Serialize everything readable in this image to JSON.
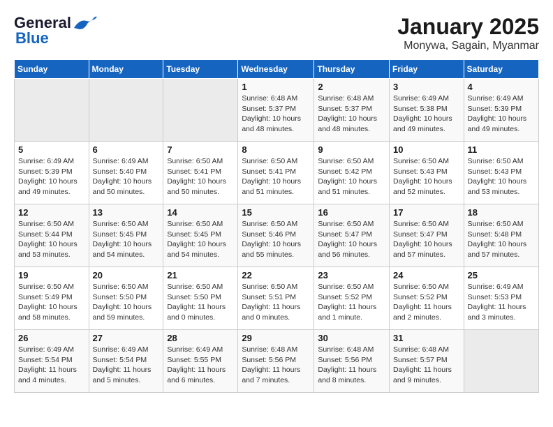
{
  "logo": {
    "line1": "General",
    "line2": "Blue"
  },
  "title": "January 2025",
  "subtitle": "Monywa, Sagain, Myanmar",
  "weekdays": [
    "Sunday",
    "Monday",
    "Tuesday",
    "Wednesday",
    "Thursday",
    "Friday",
    "Saturday"
  ],
  "weeks": [
    [
      {
        "day": "",
        "info": ""
      },
      {
        "day": "",
        "info": ""
      },
      {
        "day": "",
        "info": ""
      },
      {
        "day": "1",
        "info": "Sunrise: 6:48 AM\nSunset: 5:37 PM\nDaylight: 10 hours\nand 48 minutes."
      },
      {
        "day": "2",
        "info": "Sunrise: 6:48 AM\nSunset: 5:37 PM\nDaylight: 10 hours\nand 48 minutes."
      },
      {
        "day": "3",
        "info": "Sunrise: 6:49 AM\nSunset: 5:38 PM\nDaylight: 10 hours\nand 49 minutes."
      },
      {
        "day": "4",
        "info": "Sunrise: 6:49 AM\nSunset: 5:39 PM\nDaylight: 10 hours\nand 49 minutes."
      }
    ],
    [
      {
        "day": "5",
        "info": "Sunrise: 6:49 AM\nSunset: 5:39 PM\nDaylight: 10 hours\nand 49 minutes."
      },
      {
        "day": "6",
        "info": "Sunrise: 6:49 AM\nSunset: 5:40 PM\nDaylight: 10 hours\nand 50 minutes."
      },
      {
        "day": "7",
        "info": "Sunrise: 6:50 AM\nSunset: 5:41 PM\nDaylight: 10 hours\nand 50 minutes."
      },
      {
        "day": "8",
        "info": "Sunrise: 6:50 AM\nSunset: 5:41 PM\nDaylight: 10 hours\nand 51 minutes."
      },
      {
        "day": "9",
        "info": "Sunrise: 6:50 AM\nSunset: 5:42 PM\nDaylight: 10 hours\nand 51 minutes."
      },
      {
        "day": "10",
        "info": "Sunrise: 6:50 AM\nSunset: 5:43 PM\nDaylight: 10 hours\nand 52 minutes."
      },
      {
        "day": "11",
        "info": "Sunrise: 6:50 AM\nSunset: 5:43 PM\nDaylight: 10 hours\nand 53 minutes."
      }
    ],
    [
      {
        "day": "12",
        "info": "Sunrise: 6:50 AM\nSunset: 5:44 PM\nDaylight: 10 hours\nand 53 minutes."
      },
      {
        "day": "13",
        "info": "Sunrise: 6:50 AM\nSunset: 5:45 PM\nDaylight: 10 hours\nand 54 minutes."
      },
      {
        "day": "14",
        "info": "Sunrise: 6:50 AM\nSunset: 5:45 PM\nDaylight: 10 hours\nand 54 minutes."
      },
      {
        "day": "15",
        "info": "Sunrise: 6:50 AM\nSunset: 5:46 PM\nDaylight: 10 hours\nand 55 minutes."
      },
      {
        "day": "16",
        "info": "Sunrise: 6:50 AM\nSunset: 5:47 PM\nDaylight: 10 hours\nand 56 minutes."
      },
      {
        "day": "17",
        "info": "Sunrise: 6:50 AM\nSunset: 5:47 PM\nDaylight: 10 hours\nand 57 minutes."
      },
      {
        "day": "18",
        "info": "Sunrise: 6:50 AM\nSunset: 5:48 PM\nDaylight: 10 hours\nand 57 minutes."
      }
    ],
    [
      {
        "day": "19",
        "info": "Sunrise: 6:50 AM\nSunset: 5:49 PM\nDaylight: 10 hours\nand 58 minutes."
      },
      {
        "day": "20",
        "info": "Sunrise: 6:50 AM\nSunset: 5:50 PM\nDaylight: 10 hours\nand 59 minutes."
      },
      {
        "day": "21",
        "info": "Sunrise: 6:50 AM\nSunset: 5:50 PM\nDaylight: 11 hours\nand 0 minutes."
      },
      {
        "day": "22",
        "info": "Sunrise: 6:50 AM\nSunset: 5:51 PM\nDaylight: 11 hours\nand 0 minutes."
      },
      {
        "day": "23",
        "info": "Sunrise: 6:50 AM\nSunset: 5:52 PM\nDaylight: 11 hours\nand 1 minute."
      },
      {
        "day": "24",
        "info": "Sunrise: 6:50 AM\nSunset: 5:52 PM\nDaylight: 11 hours\nand 2 minutes."
      },
      {
        "day": "25",
        "info": "Sunrise: 6:49 AM\nSunset: 5:53 PM\nDaylight: 11 hours\nand 3 minutes."
      }
    ],
    [
      {
        "day": "26",
        "info": "Sunrise: 6:49 AM\nSunset: 5:54 PM\nDaylight: 11 hours\nand 4 minutes."
      },
      {
        "day": "27",
        "info": "Sunrise: 6:49 AM\nSunset: 5:54 PM\nDaylight: 11 hours\nand 5 minutes."
      },
      {
        "day": "28",
        "info": "Sunrise: 6:49 AM\nSunset: 5:55 PM\nDaylight: 11 hours\nand 6 minutes."
      },
      {
        "day": "29",
        "info": "Sunrise: 6:48 AM\nSunset: 5:56 PM\nDaylight: 11 hours\nand 7 minutes."
      },
      {
        "day": "30",
        "info": "Sunrise: 6:48 AM\nSunset: 5:56 PM\nDaylight: 11 hours\nand 8 minutes."
      },
      {
        "day": "31",
        "info": "Sunrise: 6:48 AM\nSunset: 5:57 PM\nDaylight: 11 hours\nand 9 minutes."
      },
      {
        "day": "",
        "info": ""
      }
    ]
  ]
}
